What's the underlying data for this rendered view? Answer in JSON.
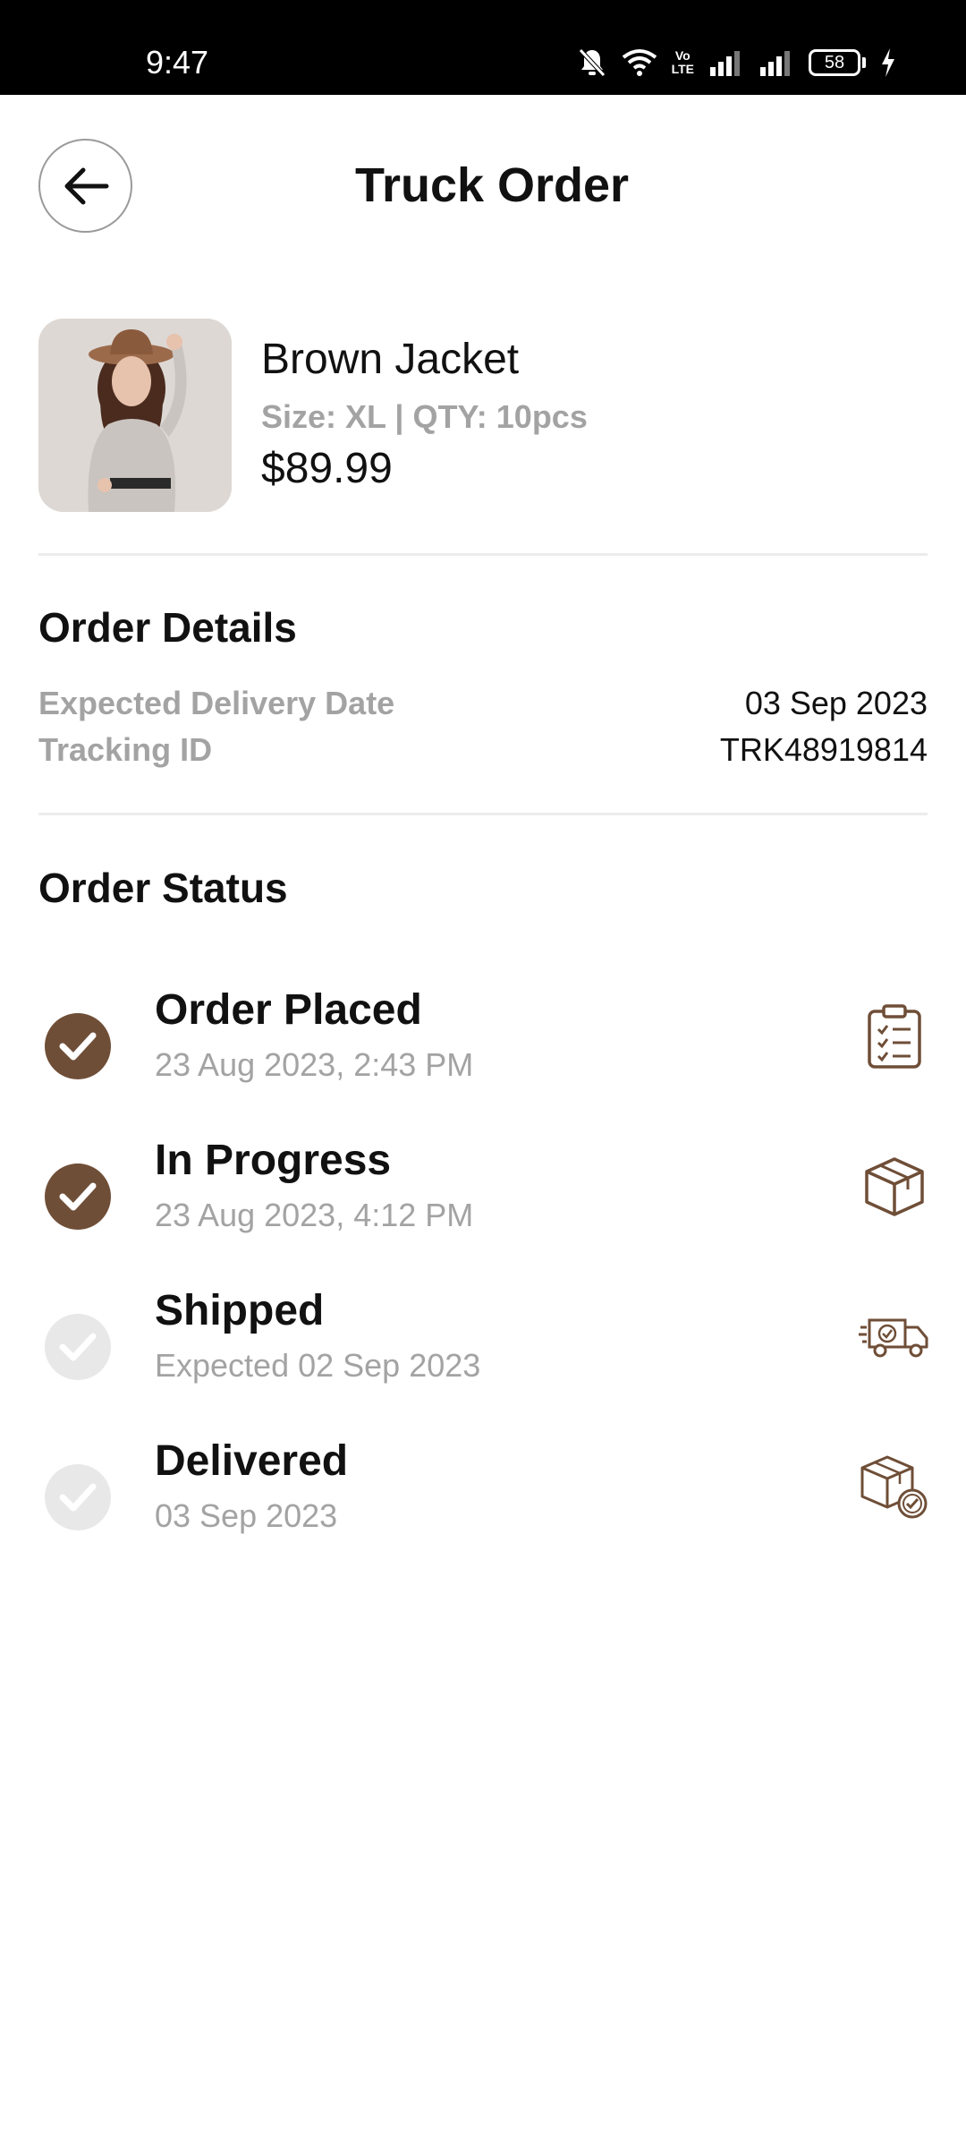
{
  "status_bar": {
    "time": "9:47",
    "volte": "Vo\nLTE",
    "battery": "58"
  },
  "header": {
    "title": "Truck Order",
    "back_icon": "arrow-left-icon"
  },
  "product": {
    "name": "Brown Jacket",
    "meta": "Size: XL | QTY: 10pcs",
    "price": "$89.99"
  },
  "order_details": {
    "title": "Order Details",
    "rows": [
      {
        "label": "Expected Delivery Date",
        "value": "03 Sep 2023"
      },
      {
        "label": "Tracking ID",
        "value": "TRK48919814"
      }
    ]
  },
  "order_status": {
    "title": "Order Status",
    "steps": [
      {
        "label": "Order Placed",
        "sub": "23 Aug 2023, 2:43 PM",
        "done": true,
        "icon": "clipboard-checklist-icon"
      },
      {
        "label": "In Progress",
        "sub": "23 Aug 2023, 4:12 PM",
        "done": true,
        "icon": "package-box-icon"
      },
      {
        "label": "Shipped",
        "sub": "Expected 02 Sep 2023",
        "done": false,
        "icon": "delivery-truck-icon"
      },
      {
        "label": "Delivered",
        "sub": "03 Sep 2023",
        "done": false,
        "icon": "package-delivered-icon"
      }
    ]
  },
  "colors": {
    "accent": "#6f4e37",
    "muted_text": "#a3a3a3",
    "pending_check": "#e8e8e8"
  }
}
